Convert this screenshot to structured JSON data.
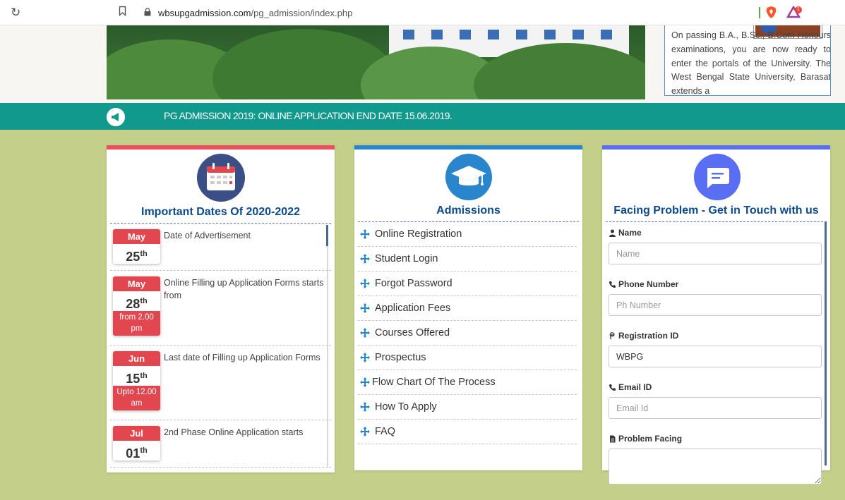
{
  "browser": {
    "url_domain": "wbsupgadmission.com",
    "url_path": "/pg_admission/index.php",
    "rewards_count": "1"
  },
  "welcome": {
    "text": "On passing B.A., B.Sc., B.Com Honours examinations, you are now ready to enter the portals of the University. The West Bengal State University, Barasat extends a"
  },
  "ticker": {
    "text": "PG ADMISSION 2019: ONLINE APPLICATION END DATE 15.06.2019."
  },
  "dates": {
    "title": "Important Dates Of 2020-2022",
    "items": [
      {
        "month": "May",
        "day": "25",
        "suffix": "th",
        "time": "",
        "text": "Date of Advertisement"
      },
      {
        "month": "May",
        "day": "28",
        "suffix": "th",
        "time": "from 2.00 pm",
        "text": "Online Filling up Application Forms starts from"
      },
      {
        "month": "Jun",
        "day": "15",
        "suffix": "th",
        "time": "Upto 12.00 am",
        "text": "Last date of Filling up Application Forms"
      },
      {
        "month": "Jul",
        "day": "01",
        "suffix": "th",
        "time": "",
        "text": "2nd Phase Online Application starts"
      }
    ]
  },
  "admissions": {
    "title": "Admissions",
    "items": [
      "Online Registration",
      "Student Login",
      "Forgot Password",
      "Application Fees",
      "Courses Offered",
      "Prospectus",
      "Flow Chart Of The Process",
      "How To Apply",
      "FAQ"
    ]
  },
  "contact": {
    "title": "Facing Problem - Get in Touch with us",
    "name_label": "Name",
    "name_placeholder": "Name",
    "phone_label": "Phone Number",
    "phone_placeholder": "Ph Number",
    "reg_label": "Registration ID",
    "reg_value": "WBPG",
    "email_label": "Email ID",
    "email_placeholder": "Email Id",
    "problem_label": "Problem Facing"
  },
  "colors": {
    "ticker_bg": "#11998e",
    "dates_accent": "#ea4f5b",
    "admissions_accent": "#2a86cc",
    "contact_accent": "#5a6ef3",
    "title_blue": "#0b4a8b",
    "page_bg": "#c4d08a"
  },
  "icons": {
    "reload": "reload-icon",
    "bookmark": "bookmark-icon",
    "lock": "lock-icon",
    "brave": "brave-shield-icon",
    "rewards": "brave-rewards-icon",
    "megaphone": "megaphone-icon",
    "calendar": "calendar-icon",
    "graduation": "graduation-cap-icon",
    "message": "message-icon",
    "move": "move-arrows-icon",
    "user": "user-icon",
    "phone": "phone-icon",
    "rupee": "rupee-icon",
    "file": "file-icon"
  }
}
